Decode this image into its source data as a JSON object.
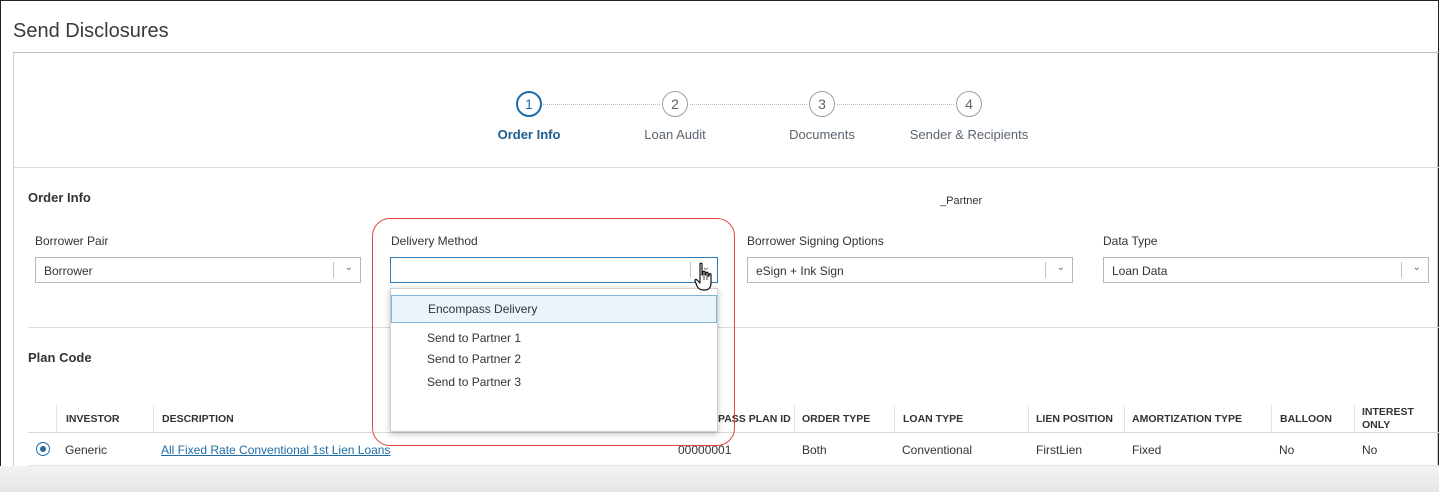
{
  "page": {
    "title": "Send Disclosures"
  },
  "stepper": [
    {
      "number": "1",
      "label": "Order Info",
      "active": true
    },
    {
      "number": "2",
      "label": "Loan Audit",
      "active": false
    },
    {
      "number": "3",
      "label": "Documents",
      "active": false
    },
    {
      "number": "4",
      "label": "Sender & Recipients",
      "active": false
    }
  ],
  "order_info": {
    "heading": "Order Info",
    "partner_text": "_Partner",
    "borrower_pair": {
      "label": "Borrower Pair",
      "value": "Borrower"
    },
    "delivery_method": {
      "label": "Delivery Method",
      "value": ""
    },
    "signing_options": {
      "label": "Borrower Signing Options",
      "value": "eSign + Ink Sign"
    },
    "data_type": {
      "label": "Data Type",
      "value": "Loan Data"
    }
  },
  "delivery_dropdown": {
    "options": [
      "Encompass Delivery",
      "Send to Partner 1",
      "Send to Partner 2",
      "Send to Partner 3"
    ],
    "selected_index": 0
  },
  "plan_code": {
    "heading": "Plan Code",
    "columns": [
      "INVESTOR",
      "DESCRIPTION",
      "PASS PLAN ID",
      "ORDER TYPE",
      "LOAN TYPE",
      "LIEN POSITION",
      "AMORTIZATION TYPE",
      "BALLOON",
      "INTEREST ONLY"
    ],
    "rows": [
      {
        "investor": "Generic",
        "description": "All Fixed Rate Conventional 1st Lien Loans",
        "plan_id": "00000001",
        "order_type": "Both",
        "loan_type": "Conventional",
        "lien_position": "FirstLien",
        "amortization_type": "Fixed",
        "balloon": "No",
        "interest_only": "No"
      }
    ]
  },
  "colors": {
    "accent": "#1e6ca6",
    "highlight": "#e04848",
    "selected_bg": "#e9f4fb"
  },
  "icons": {
    "chevron": "chevron-down-icon",
    "cursor": "hand-pointer-icon"
  }
}
